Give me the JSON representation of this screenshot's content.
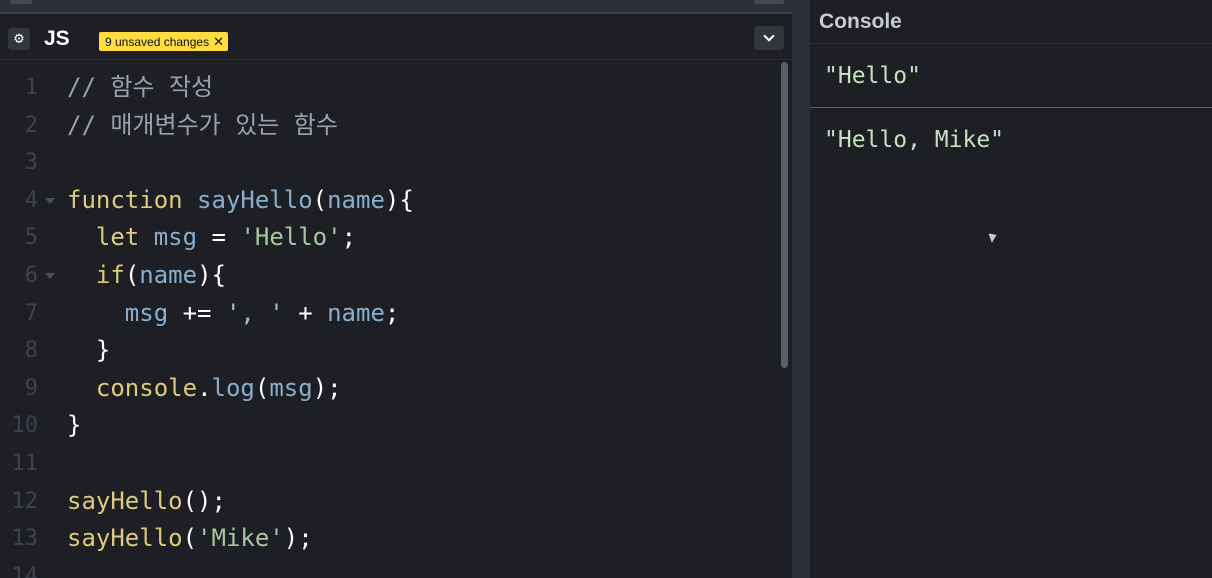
{
  "editor": {
    "language": "JS",
    "settings_icon": "gear-icon",
    "unsaved_badge": "9 unsaved changes",
    "unsaved_close": "✕",
    "dropdown_icon": "chevron-down-icon",
    "lines": [
      {
        "number": "1",
        "tokens": [
          {
            "text": "// 함수 작성",
            "kind": "comment"
          }
        ]
      },
      {
        "number": "2",
        "tokens": [
          {
            "text": "// 매개변수가 있는 함수",
            "kind": "comment"
          }
        ]
      },
      {
        "number": "3",
        "tokens": []
      },
      {
        "number": "4",
        "fold": true,
        "tokens": [
          {
            "text": "function",
            "kind": "kw"
          },
          {
            "text": " ",
            "kind": "op"
          },
          {
            "text": "sayHello",
            "kind": "id"
          },
          {
            "text": "(",
            "kind": "op"
          },
          {
            "text": "name",
            "kind": "id"
          },
          {
            "text": "){",
            "kind": "op"
          }
        ]
      },
      {
        "number": "5",
        "tokens": [
          {
            "text": "  ",
            "kind": "op"
          },
          {
            "text": "let",
            "kind": "kw"
          },
          {
            "text": " ",
            "kind": "op"
          },
          {
            "text": "msg",
            "kind": "id"
          },
          {
            "text": " = ",
            "kind": "op"
          },
          {
            "text": "'Hello'",
            "kind": "str"
          },
          {
            "text": ";",
            "kind": "op"
          }
        ]
      },
      {
        "number": "6",
        "fold": true,
        "tokens": [
          {
            "text": "  ",
            "kind": "op"
          },
          {
            "text": "if",
            "kind": "kw"
          },
          {
            "text": "(",
            "kind": "op"
          },
          {
            "text": "name",
            "kind": "id"
          },
          {
            "text": "){",
            "kind": "op"
          }
        ]
      },
      {
        "number": "7",
        "tokens": [
          {
            "text": "    ",
            "kind": "op"
          },
          {
            "text": "msg",
            "kind": "id"
          },
          {
            "text": " += ",
            "kind": "op"
          },
          {
            "text": "', '",
            "kind": "str"
          },
          {
            "text": " + ",
            "kind": "op"
          },
          {
            "text": "name",
            "kind": "id"
          },
          {
            "text": ";",
            "kind": "op"
          }
        ]
      },
      {
        "number": "8",
        "tokens": [
          {
            "text": "  }",
            "kind": "op"
          }
        ]
      },
      {
        "number": "9",
        "tokens": [
          {
            "text": "  ",
            "kind": "op"
          },
          {
            "text": "console",
            "kind": "fn"
          },
          {
            "text": ".",
            "kind": "op"
          },
          {
            "text": "log",
            "kind": "id"
          },
          {
            "text": "(",
            "kind": "op"
          },
          {
            "text": "msg",
            "kind": "id"
          },
          {
            "text": ");",
            "kind": "op"
          }
        ]
      },
      {
        "number": "10",
        "tokens": [
          {
            "text": "}",
            "kind": "op"
          }
        ]
      },
      {
        "number": "11",
        "tokens": []
      },
      {
        "number": "12",
        "tokens": [
          {
            "text": "sayHello",
            "kind": "fn"
          },
          {
            "text": "();",
            "kind": "op"
          }
        ]
      },
      {
        "number": "13",
        "tokens": [
          {
            "text": "sayHello",
            "kind": "fn"
          },
          {
            "text": "(",
            "kind": "op"
          },
          {
            "text": "'Mike'",
            "kind": "str"
          },
          {
            "text": ");",
            "kind": "op"
          }
        ]
      },
      {
        "number": "14",
        "tokens": []
      }
    ]
  },
  "console": {
    "title": "Console",
    "entries": [
      "\"Hello\"",
      "\"Hello, Mike\""
    ]
  },
  "colors": {
    "background": "#1e1f24",
    "badge": "#ffdd40",
    "keyword": "#ddca7e",
    "identifier": "#88aece",
    "string": "#a7c7a0",
    "comment": "#9aa0ad"
  }
}
